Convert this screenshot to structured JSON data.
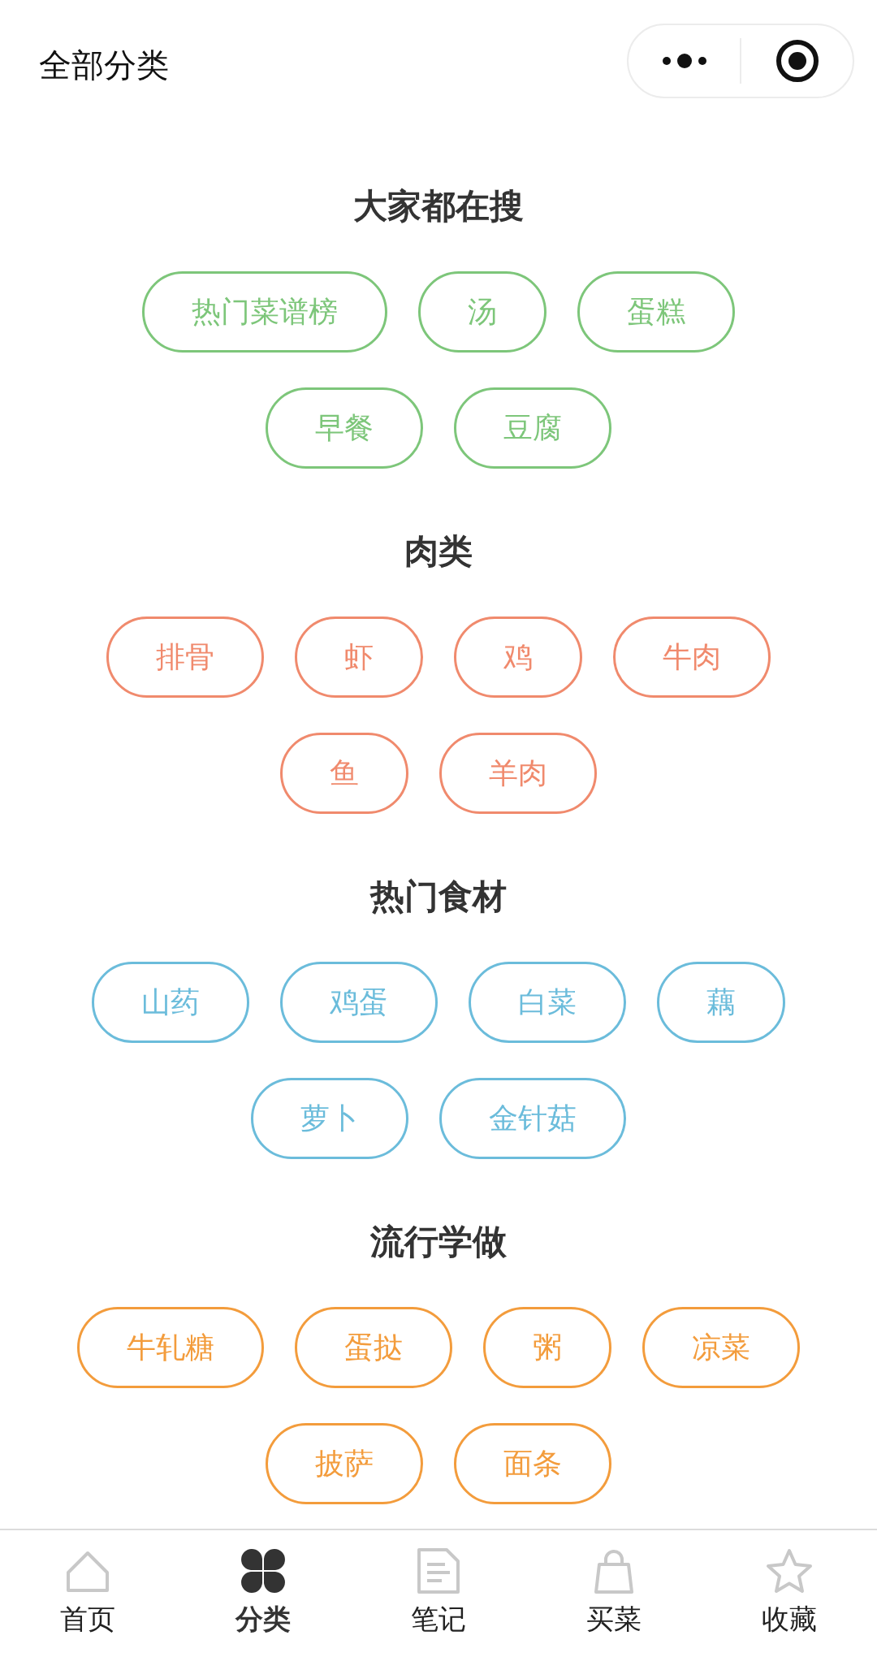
{
  "header": {
    "title": "全部分类"
  },
  "sections": [
    {
      "title": "大家都在搜",
      "color": "#7dc67a",
      "tags": [
        "热门菜谱榜",
        "汤",
        "蛋糕",
        "早餐",
        "豆腐"
      ]
    },
    {
      "title": "肉类",
      "color": "#f08a6d",
      "tags": [
        "排骨",
        "虾",
        "鸡",
        "牛肉",
        "鱼",
        "羊肉"
      ]
    },
    {
      "title": "热门食材",
      "color": "#6bbcdb",
      "tags": [
        "山药",
        "鸡蛋",
        "白菜",
        "藕",
        "萝卜",
        "金针菇"
      ]
    },
    {
      "title": "流行学做",
      "color": "#f39c3c",
      "tags": [
        "牛轧糖",
        "蛋挞",
        "粥",
        "凉菜",
        "披萨",
        "面条"
      ]
    }
  ],
  "tab_bar": [
    {
      "kind": "home",
      "label": "首页",
      "selected": false
    },
    {
      "kind": "category",
      "label": "分类",
      "selected": true
    },
    {
      "kind": "notes",
      "label": "笔记",
      "selected": false
    },
    {
      "kind": "shop",
      "label": "买菜",
      "selected": false
    },
    {
      "kind": "favorite",
      "label": "收藏",
      "selected": false
    }
  ]
}
